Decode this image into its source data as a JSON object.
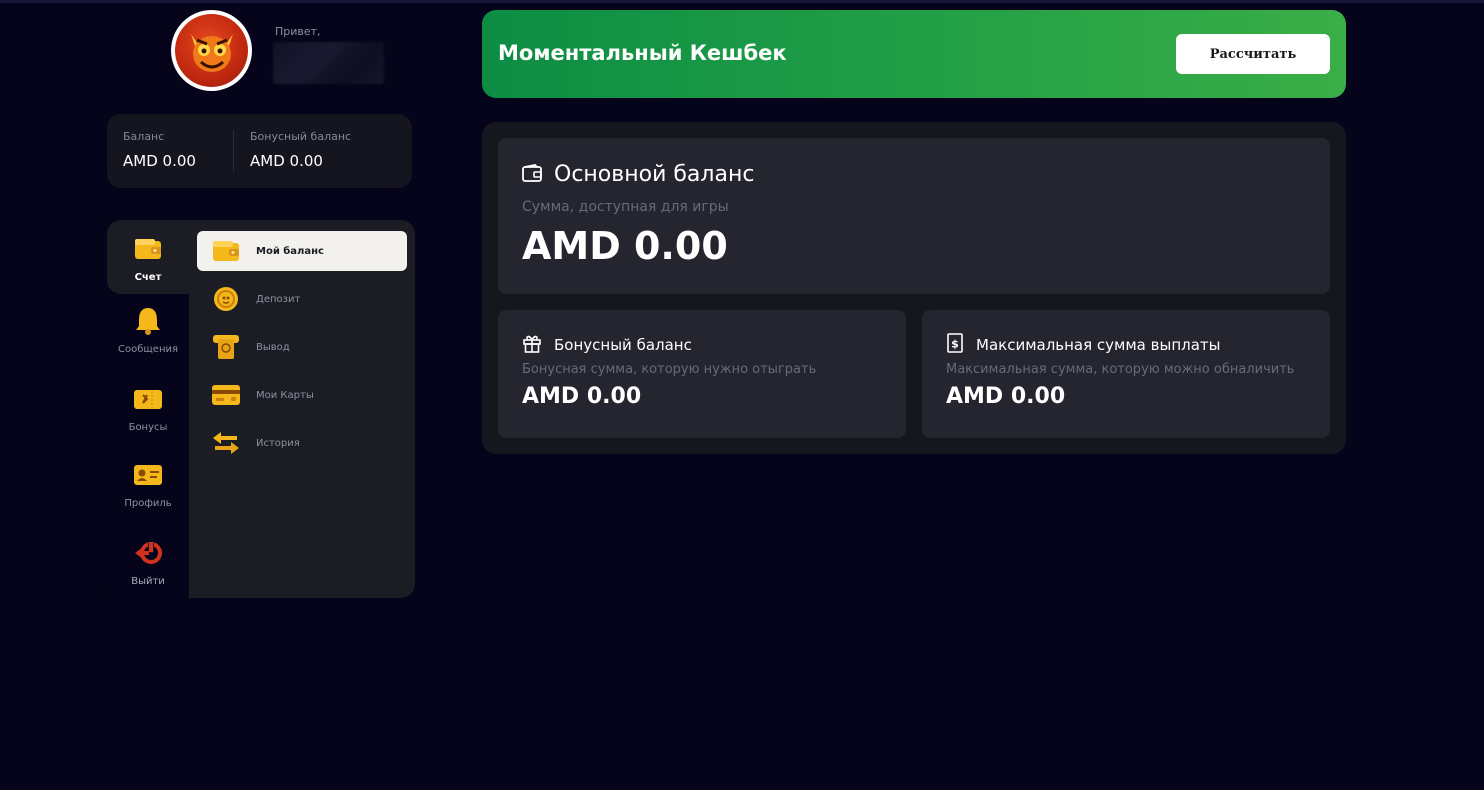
{
  "user": {
    "greeting": "Привет,",
    "avatar_icon": "devil-mascot-icon"
  },
  "balances": {
    "main_label": "Баланс",
    "main_value": "AMD 0.00",
    "bonus_label": "Бонусный баланс",
    "bonus_value": "AMD 0.00"
  },
  "categories": [
    {
      "label": "Счет",
      "icon": "wallet-icon",
      "active": true
    },
    {
      "label": "Сообщения",
      "icon": "bell-icon",
      "active": false
    },
    {
      "label": "Бонусы",
      "icon": "bonus-ticket-icon",
      "active": false
    },
    {
      "label": "Профиль",
      "icon": "profile-card-icon",
      "active": false
    },
    {
      "label": "Выйти",
      "icon": "logout-icon",
      "active": false
    }
  ],
  "submenu": [
    {
      "label": "Мой баланс",
      "icon": "wallet-icon",
      "active": true
    },
    {
      "label": "Депозит",
      "icon": "coin-icon",
      "active": false
    },
    {
      "label": "Вывод",
      "icon": "withdraw-icon",
      "active": false
    },
    {
      "label": "Мои Карты",
      "icon": "card-icon",
      "active": false
    },
    {
      "label": "История",
      "icon": "arrows-swap-icon",
      "active": false
    }
  ],
  "cashback": {
    "title": "Моментальный Кешбек",
    "button": "Рассчитать"
  },
  "main_balance": {
    "title": "Основной баланс",
    "subtitle": "Сумма, доступная для игры",
    "value": "AMD 0.00"
  },
  "bonus_balance": {
    "title": "Бонусный баланс",
    "subtitle": "Бонусная сумма, которую нужно отыграть",
    "value": "AMD 0.00"
  },
  "max_payout": {
    "title": "Максимальная сумма выплаты",
    "subtitle": "Максимальная сумма, которую можно обналичить",
    "value": "AMD 0.00"
  },
  "colors": {
    "background": "#05041a",
    "accent_yellow": "#f5b81b",
    "cashback_green_start": "#0d8d44",
    "cashback_green_end": "#3aae47",
    "logout_red": "#d0321e"
  }
}
